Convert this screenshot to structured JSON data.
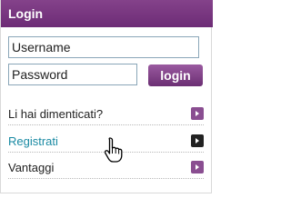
{
  "header": {
    "title": "Login"
  },
  "form": {
    "username_placeholder": "Username",
    "password_placeholder": "Password",
    "login_label": "login"
  },
  "links": [
    {
      "label": "Li hai dimenticati?",
      "icon": "arrow-right-icon"
    },
    {
      "label": "Registrati",
      "icon": "arrow-right-icon"
    },
    {
      "label": "Vantaggi",
      "icon": "arrow-right-icon"
    }
  ],
  "colors": {
    "header": "#7a3a82",
    "link_active": "#1a8aa3",
    "arrow_button": "#8a4e91",
    "arrow_button_active": "#222222"
  },
  "cursor": {
    "icon": "hand-pointer-icon"
  }
}
